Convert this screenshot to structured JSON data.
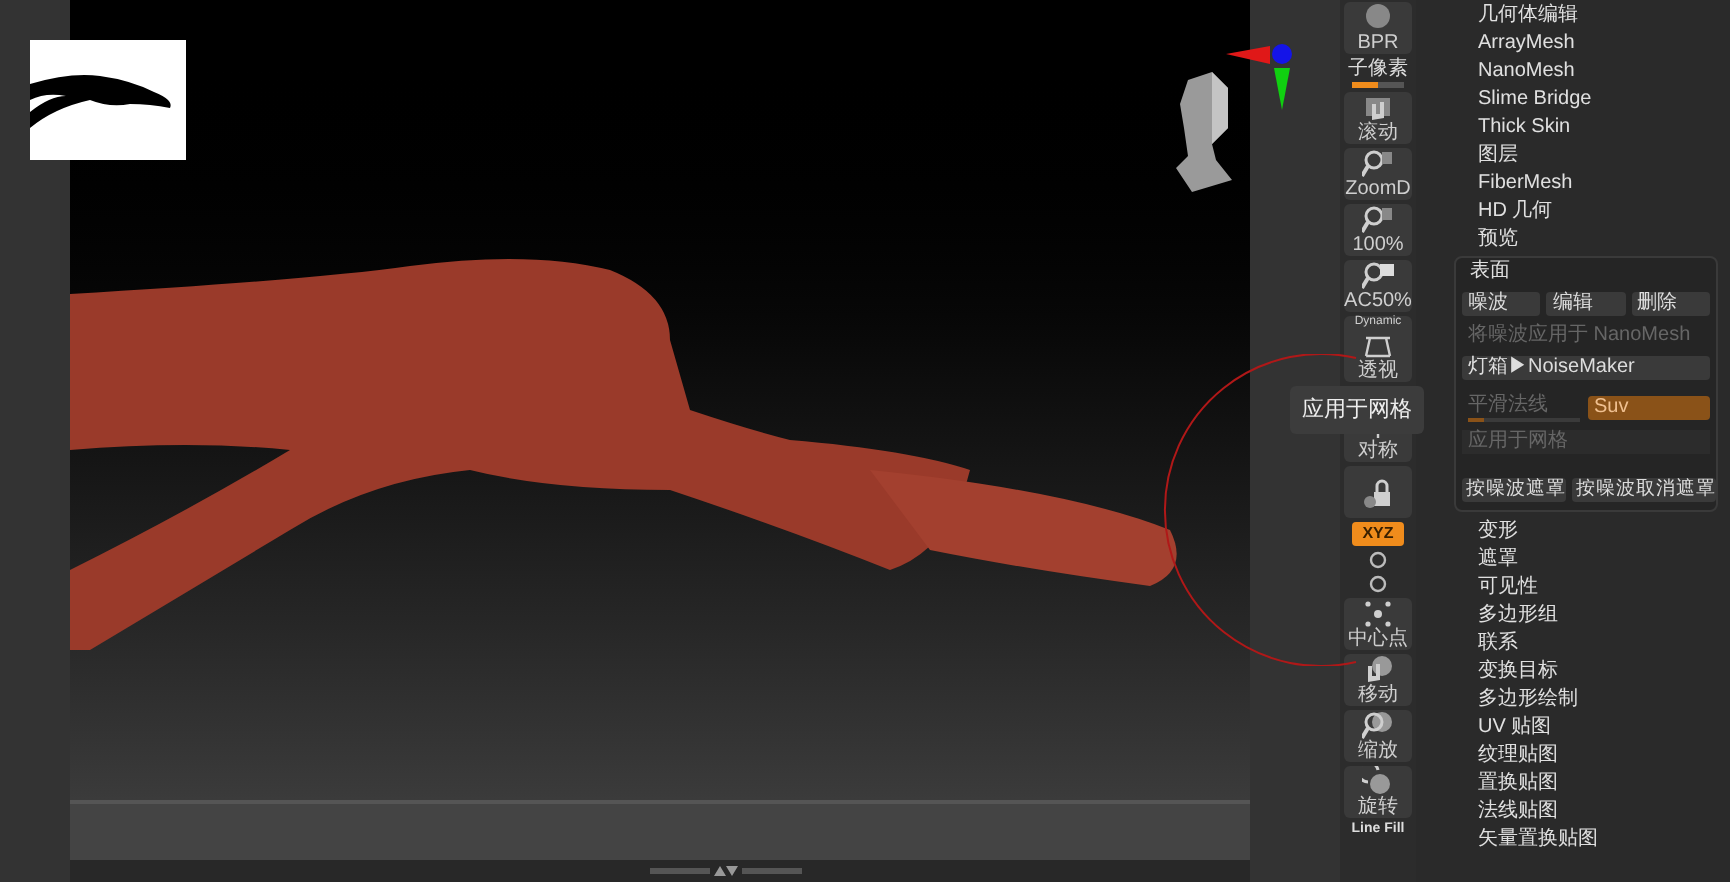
{
  "toolbar": [
    {
      "kind": "button",
      "label": "BPR"
    },
    {
      "kind": "slider",
      "label": "子像素",
      "level": 0.5
    },
    {
      "kind": "button",
      "label": "滚动"
    },
    {
      "kind": "button",
      "label": "ZoomD"
    },
    {
      "kind": "button",
      "label": "100%"
    },
    {
      "kind": "button",
      "label": "AC50%"
    },
    {
      "kind": "button",
      "caption": "Dynamic",
      "label": "透视"
    },
    {
      "kind": "mini"
    },
    {
      "kind": "button",
      "label": "对称"
    },
    {
      "kind": "button"
    },
    {
      "kind": "toggle",
      "label": "XYZ",
      "on": true
    },
    {
      "kind": "mini"
    },
    {
      "kind": "mini"
    },
    {
      "kind": "button",
      "label": "中心点"
    },
    {
      "kind": "button",
      "label": "移动"
    },
    {
      "kind": "button",
      "label": "缩放"
    },
    {
      "kind": "button",
      "label": "旋转"
    },
    {
      "kind": "text",
      "label": "Line Fill"
    }
  ],
  "tooltip": "应用于网格",
  "menu_top": [
    "几何体编辑",
    "ArrayMesh",
    "NanoMesh",
    "Slime Bridge",
    "Thick Skin",
    "图层",
    "FiberMesh",
    "HD 几何",
    "预览"
  ],
  "surface_panel": {
    "title": "表面",
    "buttons": [
      "噪波",
      "编辑",
      "删除"
    ],
    "apply_nanomesh": {
      "label": "将噪波应用于 NanoMesh",
      "disabled": true
    },
    "lightbox": "灯箱▶NoiseMaker",
    "smooth_normals": {
      "label": "平滑法线",
      "level": 0.15,
      "disabled": true
    },
    "suv": {
      "label": "Suv",
      "disabled": true
    },
    "apply_mesh": {
      "label": "应用于网格",
      "disabled": true
    },
    "mask_buttons": [
      "按噪波遮罩",
      "按噪波取消遮罩"
    ]
  },
  "menu_bottom": [
    "变形",
    "遮罩",
    "可见性",
    "多边形组",
    "联系",
    "变换目标",
    "多边形绘制",
    "UV 贴图",
    "纹理贴图",
    "置换贴图",
    "法线贴图",
    "矢量置换贴图"
  ]
}
